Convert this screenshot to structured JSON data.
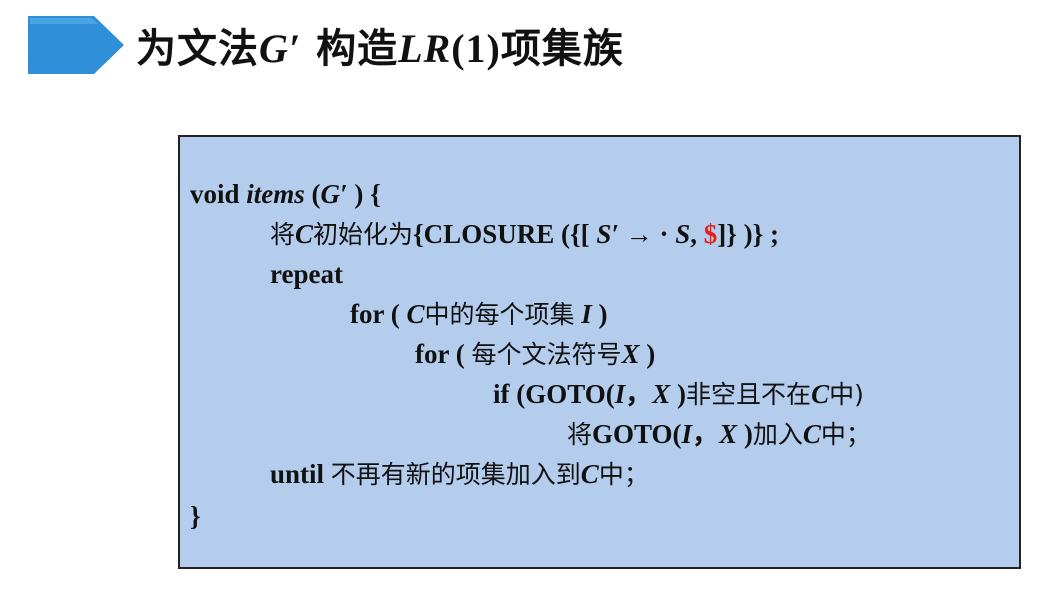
{
  "title": {
    "prefix": "为文法",
    "grammar": "G′",
    "middle": " 构造",
    "lr": "LR",
    "lr_arg": "(1)",
    "suffix": "项集族"
  },
  "code": {
    "l1": {
      "a": "void ",
      "b": "items",
      "c": " (",
      "d": "G′",
      "e": " ) {"
    },
    "l2": {
      "a": "将",
      "b": "C",
      "c": "初始化为",
      "d": "{CLOSURE ({[ ",
      "e": "S′",
      "f": " → · ",
      "g": "S",
      "h": ", ",
      "i": "$",
      "j": "]} )}   ;"
    },
    "l3": {
      "a": "repeat"
    },
    "l4": {
      "a": "for ( ",
      "b": "C",
      "c": "中的每个项集",
      "d": " ",
      "e": "I",
      "f": " )"
    },
    "l5": {
      "a": "for ( ",
      "b": "每个文法符号",
      "c": "X",
      "d": " )"
    },
    "l6": {
      "a": "if (GOTO(",
      "b": "I",
      "c": "，",
      "d": "X",
      "e": " )",
      "f": "非空且不在",
      "g": "C",
      "h": "中)"
    },
    "l7": {
      "a": "将",
      "b": "GOTO(",
      "c": "I",
      "d": "，",
      "e": "X",
      "f": " )",
      "g": "加入",
      "h": "C",
      "i": "中；"
    },
    "l8": {
      "a": "until ",
      "b": "不再有新的项集加入到",
      "c": "C",
      "d": "中；"
    },
    "l9": {
      "a": "}"
    }
  },
  "colors": {
    "title_arrow": "#2f8fd8",
    "box_bg": "#b4cdec",
    "dollar": "#e8201c"
  }
}
